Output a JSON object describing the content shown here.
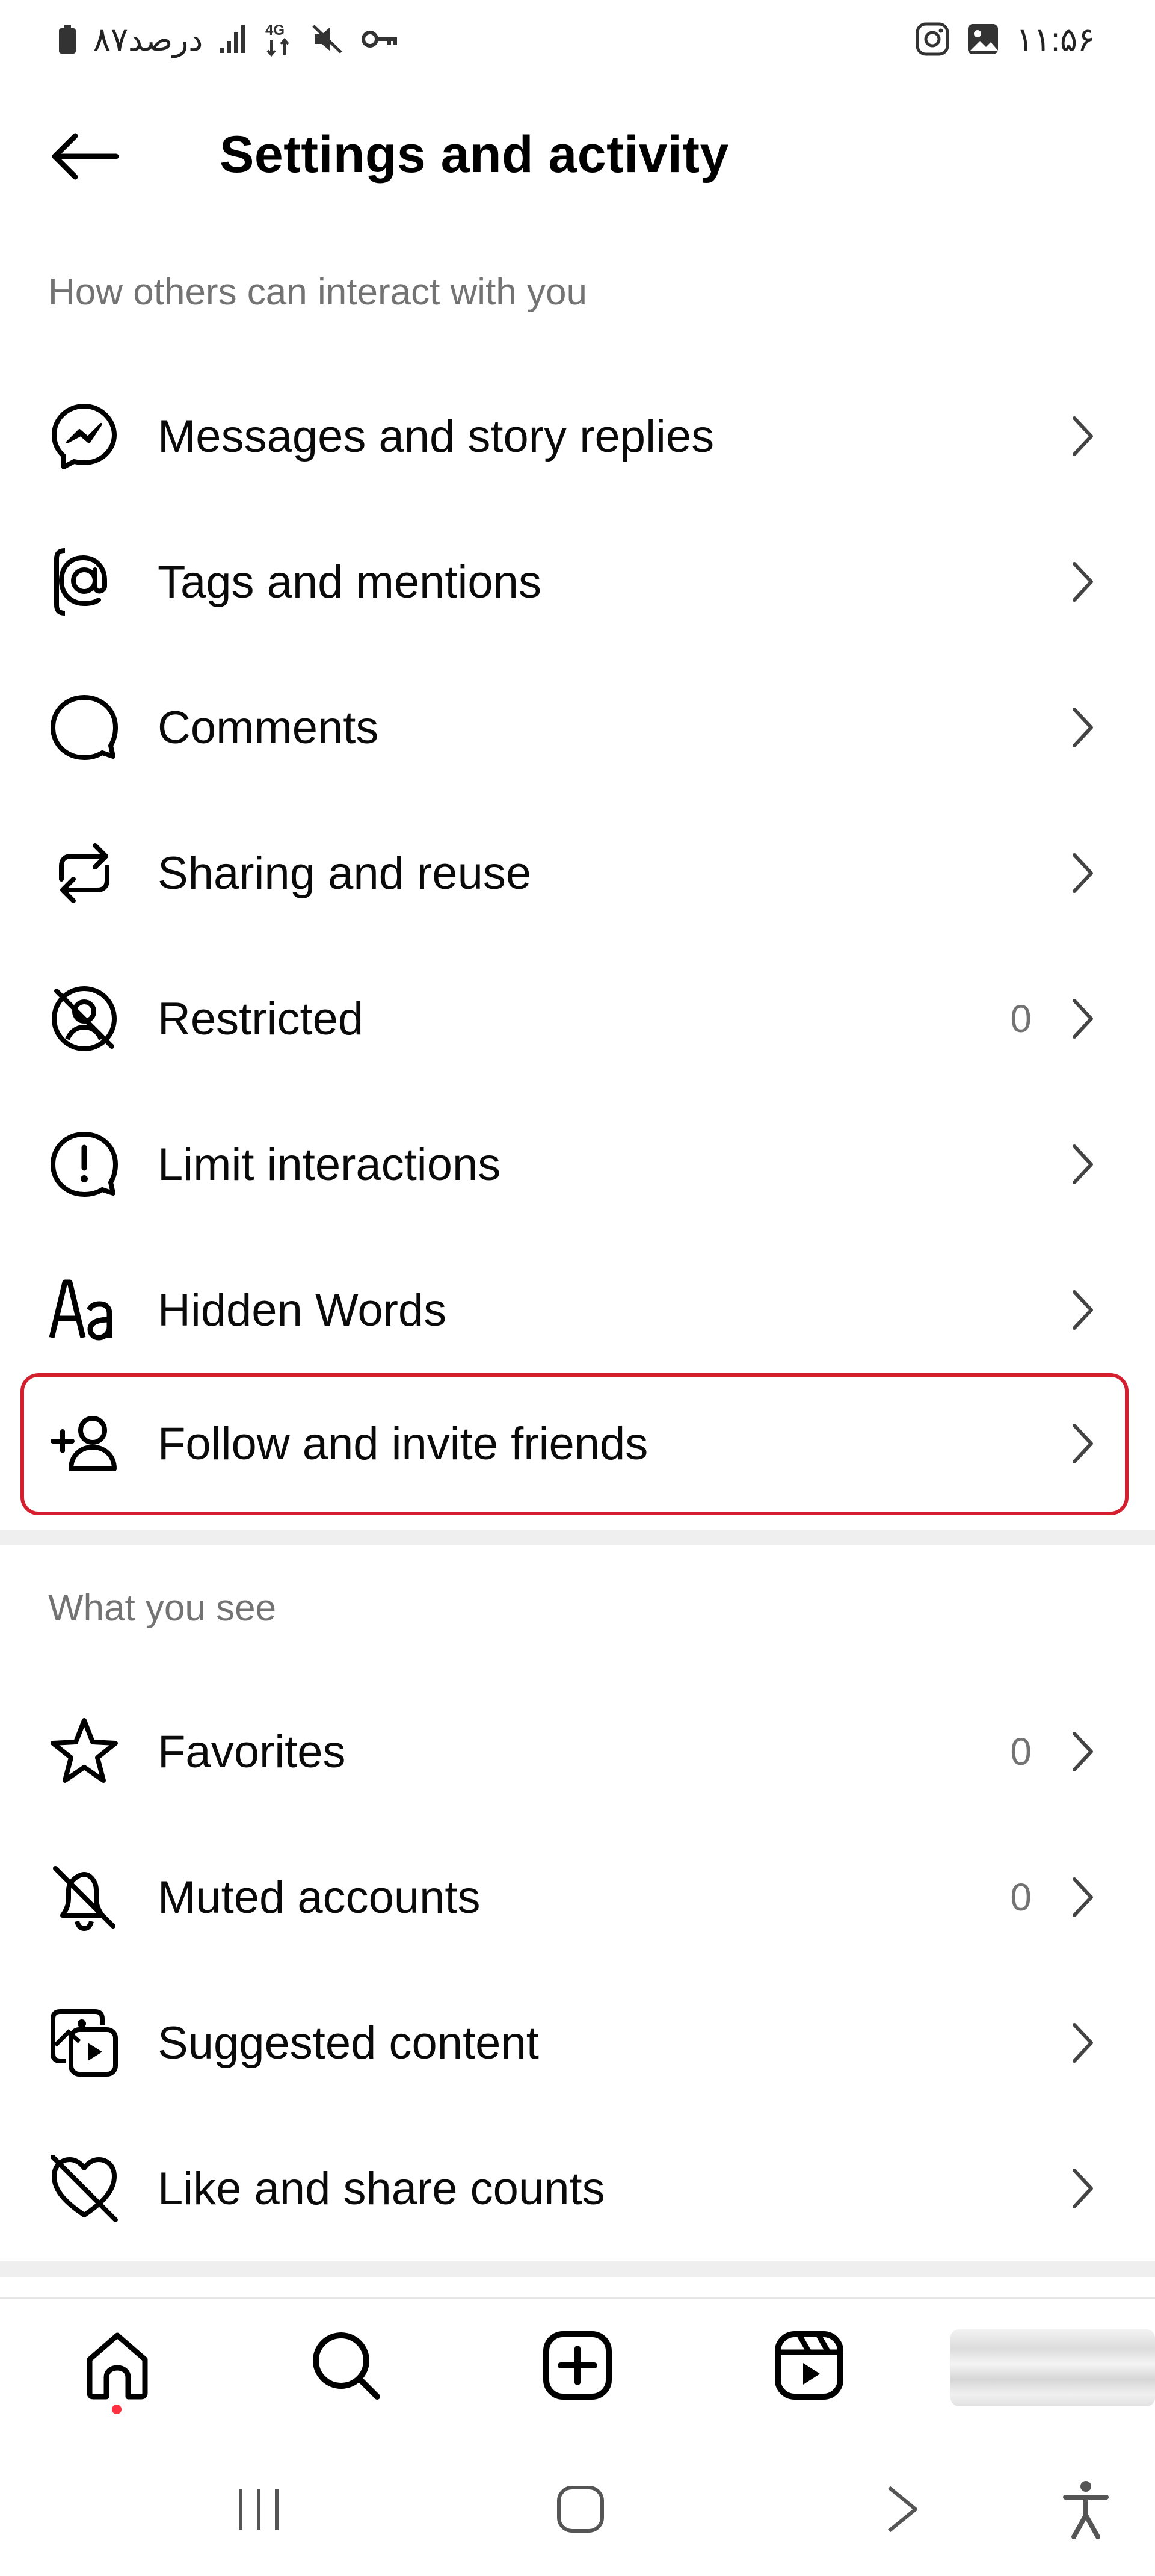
{
  "status_bar": {
    "battery_text": "۸۷درصد",
    "network_type": "4G",
    "time": "۱۱:۵۶",
    "left_icons": [
      "battery-icon",
      "signal-icon",
      "data-4g-icon",
      "mute-icon",
      "vpn-key-icon"
    ],
    "right_icons": [
      "instagram-icon",
      "gallery-icon"
    ]
  },
  "header": {
    "title": "Settings and activity",
    "back_icon": "arrow-left-icon"
  },
  "sections": [
    {
      "title": "How others can interact with you",
      "items": [
        {
          "label": "Messages and story replies",
          "icon": "messenger-icon",
          "count": ""
        },
        {
          "label": "Tags and mentions",
          "icon": "at-sign-icon",
          "count": ""
        },
        {
          "label": "Comments",
          "icon": "comment-bubble-icon",
          "count": ""
        },
        {
          "label": "Sharing and reuse",
          "icon": "repost-icon",
          "count": ""
        },
        {
          "label": "Restricted",
          "icon": "restricted-icon",
          "count": "0"
        },
        {
          "label": "Limit interactions",
          "icon": "alert-bubble-icon",
          "count": ""
        },
        {
          "label": "Hidden Words",
          "icon": "text-aa-icon",
          "count": ""
        },
        {
          "label": "Follow and invite friends",
          "icon": "add-person-icon",
          "count": "",
          "highlighted": true
        }
      ]
    },
    {
      "title": "What you see",
      "items": [
        {
          "label": "Favorites",
          "icon": "star-icon",
          "count": "0"
        },
        {
          "label": "Muted accounts",
          "icon": "bell-off-icon",
          "count": "0"
        },
        {
          "label": "Suggested content",
          "icon": "media-play-icon",
          "count": ""
        },
        {
          "label": "Like and share counts",
          "icon": "heart-off-icon",
          "count": ""
        }
      ]
    }
  ],
  "highlight_color": "#d51f2e",
  "bottom_nav": {
    "items": [
      "home-icon",
      "search-icon",
      "create-icon",
      "reels-icon",
      "profile-avatar"
    ],
    "active": "home-icon",
    "notification_dot_color": "#ff3040"
  },
  "system_nav": [
    "recents-icon",
    "home-circle-icon",
    "back-chevron-icon",
    "accessibility-icon"
  ]
}
